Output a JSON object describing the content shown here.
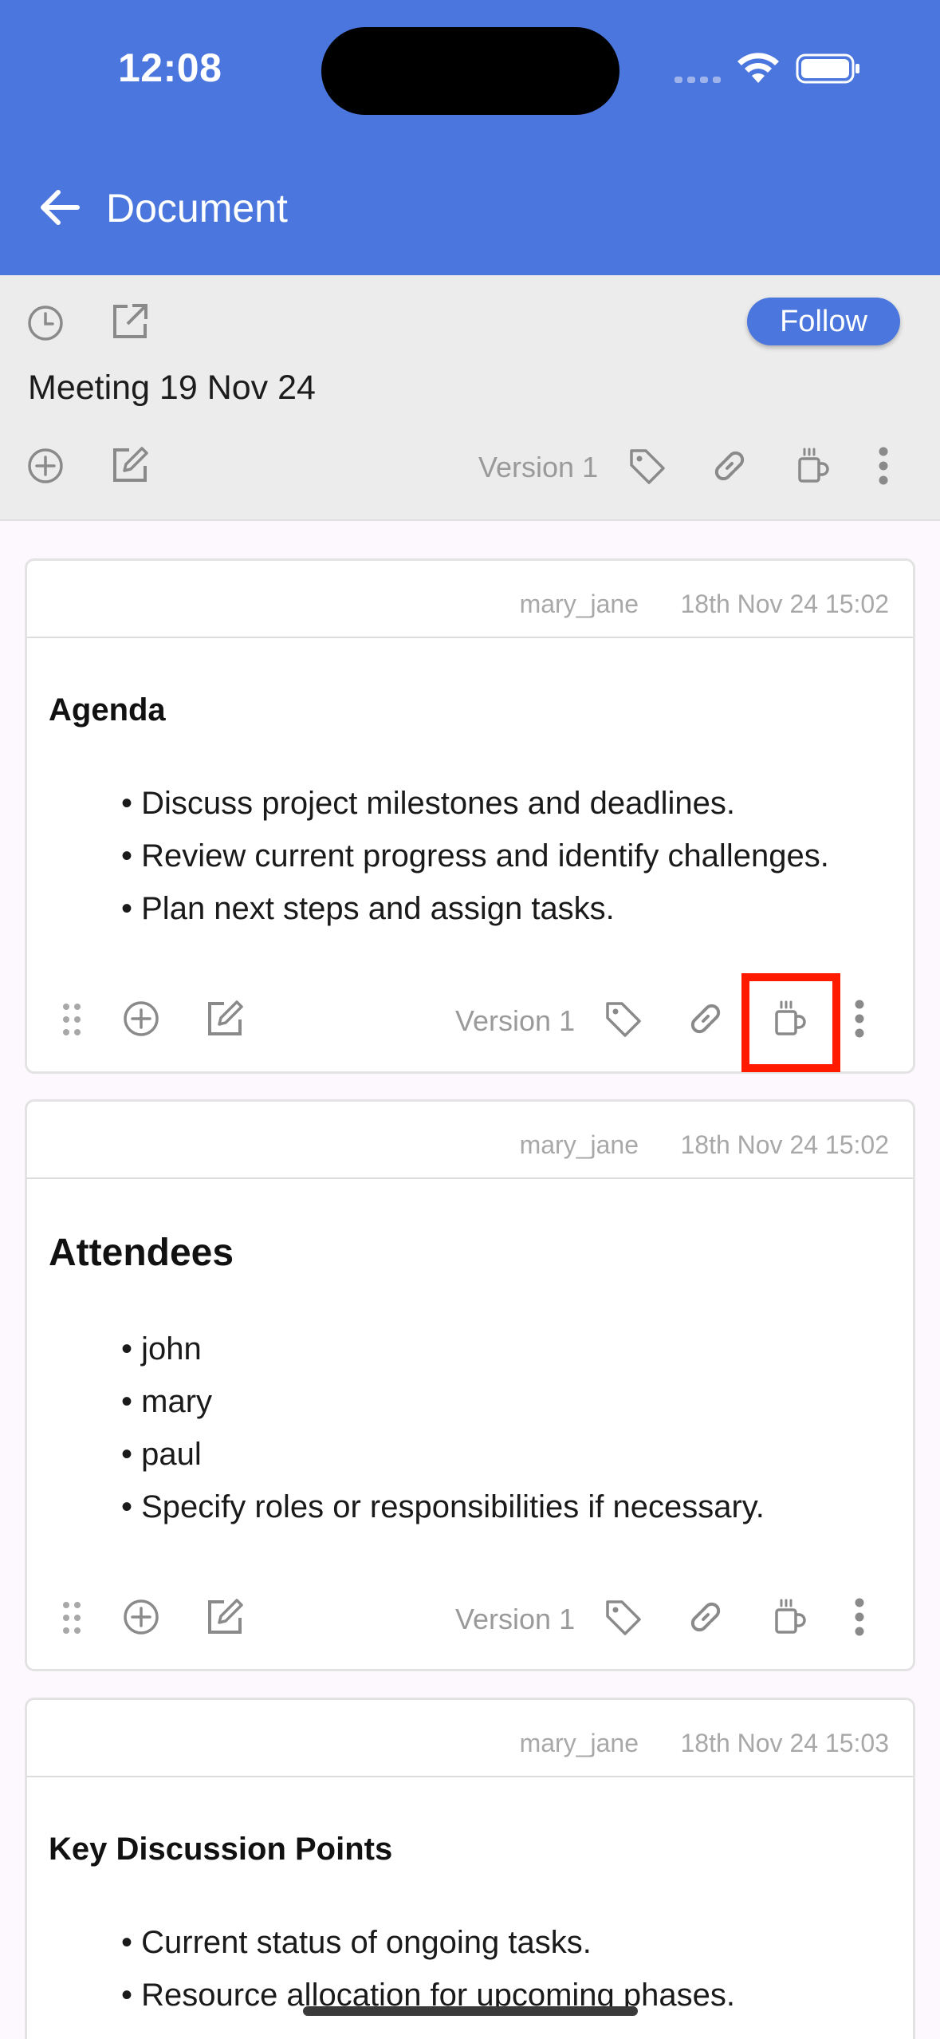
{
  "status_bar": {
    "time": "12:08"
  },
  "app_bar": {
    "title": "Document"
  },
  "doc_header": {
    "follow_label": "Follow",
    "document_name": "Meeting 19 Nov 24",
    "version_label": "Version 1"
  },
  "cards": [
    {
      "author": "mary_jane",
      "date": "18th Nov 24 15:02",
      "heading": "Agenda",
      "items": [
        "Discuss project milestones and deadlines.",
        "Review current progress and identify challenges.",
        "Plan next steps and assign tasks."
      ],
      "version_label": "Version 1"
    },
    {
      "author": "mary_jane",
      "date": "18th Nov 24 15:02",
      "heading": "Attendees",
      "items": [
        "john",
        "mary",
        "paul",
        "Specify roles or responsibilities if necessary."
      ],
      "version_label": "Version 1"
    },
    {
      "author": "mary_jane",
      "date": "18th Nov 24 15:03",
      "heading": "Key Discussion Points",
      "items": [
        "Current status of ongoing tasks.",
        "Resource allocation for upcoming phases."
      ]
    }
  ],
  "colors": {
    "primary": "#4a76dd",
    "highlight": "#ff1a00"
  }
}
